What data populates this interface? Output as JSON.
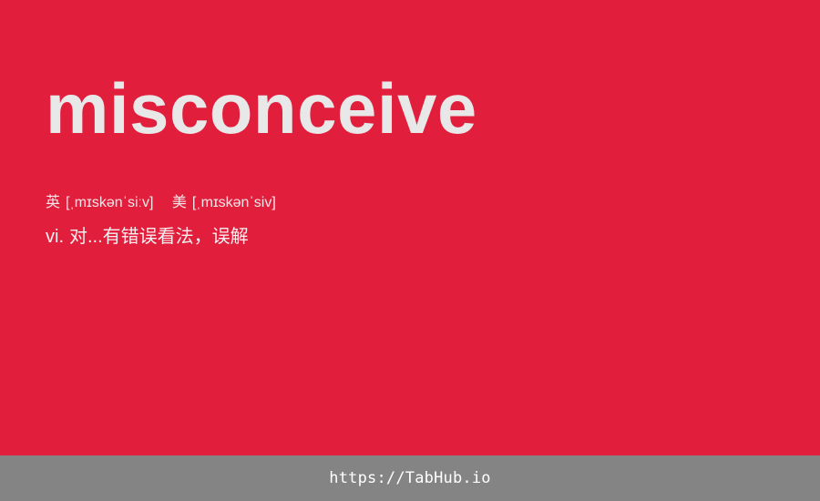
{
  "word": "misconceive",
  "phonetics": {
    "uk": {
      "label": "英",
      "ipa": "[ˌmɪskənˈsiːv]"
    },
    "us": {
      "label": "美",
      "ipa": "[ˌmɪskənˈsiv]"
    }
  },
  "definition": {
    "pos": "vi.",
    "text": "对...有错误看法，误解"
  },
  "footer": {
    "link": "https://TabHub.io"
  },
  "colors": {
    "card_background": "#e11f3d",
    "footer_background": "#848484",
    "word_text": "#e8e8e8"
  }
}
